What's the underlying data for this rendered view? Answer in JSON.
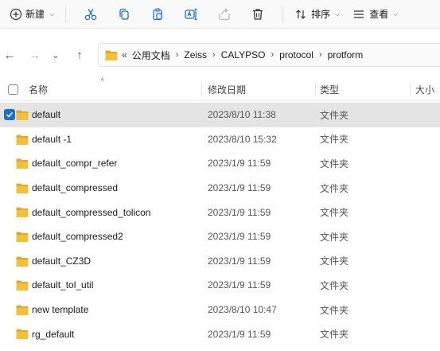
{
  "toolbar": {
    "new_label": "新建",
    "sort_label": "排序",
    "view_label": "查看",
    "icons": [
      "plus-circle-icon",
      "cut-icon",
      "copy-icon",
      "paste-icon",
      "rename-icon",
      "share-icon",
      "delete-icon",
      "sort-icon",
      "view-icon"
    ]
  },
  "address": {
    "overflow_glyph": "«",
    "crumbs": [
      "公用文档",
      "Zeiss",
      "CALYPSO",
      "protocol",
      "protform"
    ],
    "separator": "›"
  },
  "nav": {
    "back": "←",
    "forward": "→",
    "recent": "⌄",
    "up": "↑"
  },
  "columns": {
    "name": "名称",
    "date": "修改日期",
    "type": "类型",
    "size": "大小",
    "sort_indicator": "˄"
  },
  "files": [
    {
      "name": "default",
      "date": "2023/8/10 11:38",
      "type": "文件夹",
      "selected": true
    },
    {
      "name": "default -1",
      "date": "2023/8/10 15:32",
      "type": "文件夹",
      "selected": false
    },
    {
      "name": "default_compr_refer",
      "date": "2023/1/9 11:59",
      "type": "文件夹",
      "selected": false
    },
    {
      "name": "default_compressed",
      "date": "2023/1/9 11:59",
      "type": "文件夹",
      "selected": false
    },
    {
      "name": "default_compressed_tolicon",
      "date": "2023/1/9 11:59",
      "type": "文件夹",
      "selected": false
    },
    {
      "name": "default_compressed2",
      "date": "2023/1/9 11:59",
      "type": "文件夹",
      "selected": false
    },
    {
      "name": "default_CZ3D",
      "date": "2023/1/9 11:59",
      "type": "文件夹",
      "selected": false
    },
    {
      "name": "default_tol_util",
      "date": "2023/1/9 11:59",
      "type": "文件夹",
      "selected": false
    },
    {
      "name": "new template",
      "date": "2023/8/10 10:47",
      "type": "文件夹",
      "selected": false
    },
    {
      "name": "rg_default",
      "date": "2023/1/9 11:59",
      "type": "文件夹",
      "selected": false
    }
  ],
  "colors": {
    "accent": "#1a6fd0",
    "folder": "#f3c03b",
    "folder_dark": "#e0a91f",
    "selected_row": "#e4e4e4"
  }
}
